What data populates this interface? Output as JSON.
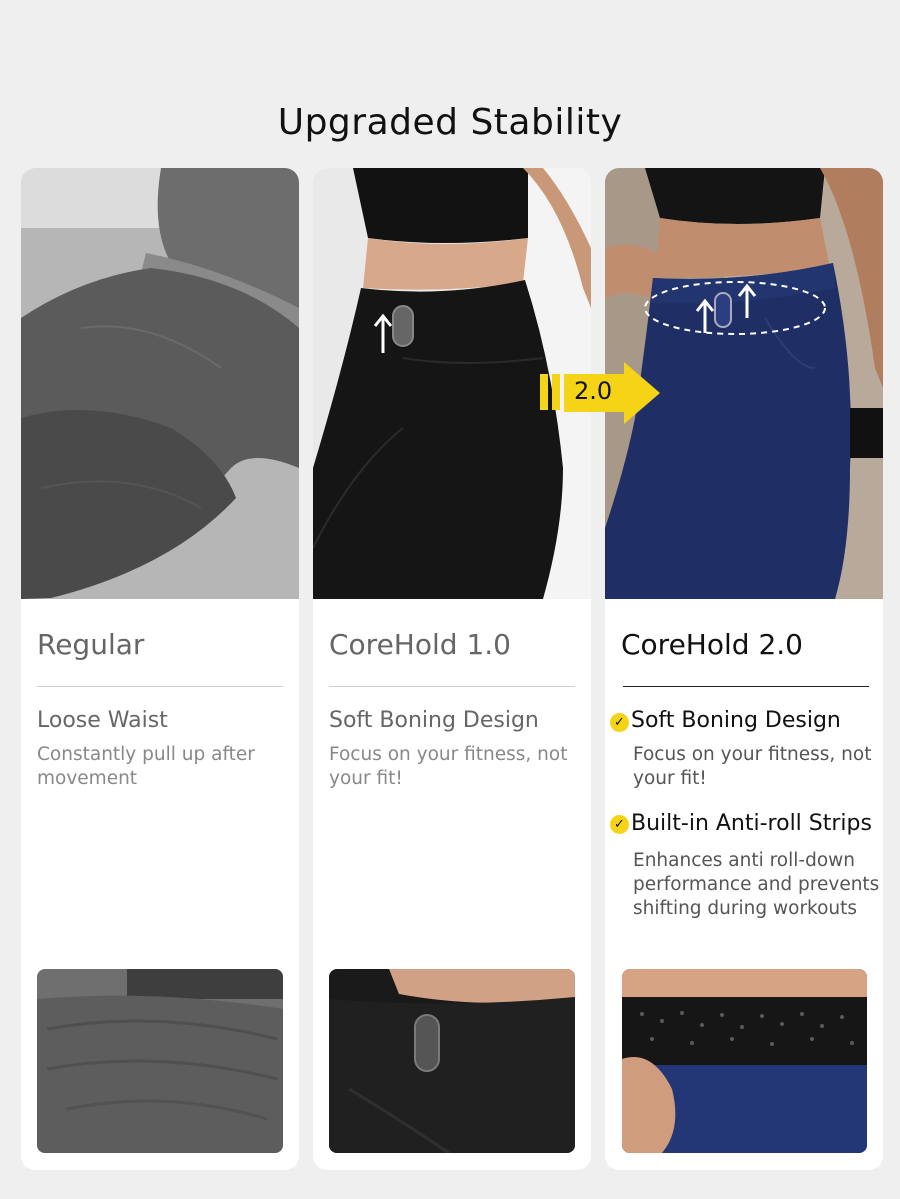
{
  "header": {
    "title": "Upgraded Stability"
  },
  "upgrade_badge": {
    "label": "2.0",
    "color": "#f5d417"
  },
  "tiers": [
    {
      "name": "Regular",
      "features": [
        {
          "title": "Loose Waist",
          "description": "Constantly pull up after movement"
        }
      ],
      "legging_color": "#5b5b5b"
    },
    {
      "name": "CoreHold 1.0",
      "features": [
        {
          "title": "Soft Boning Design",
          "description": "Focus on your fitness, not your fit!"
        }
      ],
      "legging_color": "#151515"
    },
    {
      "name": "CoreHold 2.0",
      "features": [
        {
          "title": "Soft Boning Design",
          "description": "Focus on your fitness, not your fit!",
          "icon": "check-circle-icon"
        },
        {
          "title": "Built-in Anti-roll Strips",
          "description": "Enhances anti roll-down performance and prevents shifting during workouts",
          "icon": "check-circle-icon"
        }
      ],
      "legging_color": "#1f2f66"
    }
  ]
}
